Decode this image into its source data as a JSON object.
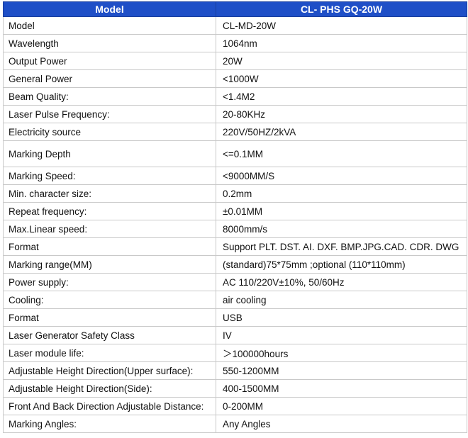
{
  "header": {
    "label_col": "Model",
    "value_col": "CL- PHS GQ-20W"
  },
  "rows": [
    {
      "label": "Model",
      "value": "CL-MD-20W"
    },
    {
      "label": "Wavelength",
      "value": "1064nm"
    },
    {
      "label": "Output Power",
      "value": "20W"
    },
    {
      "label": "General Power",
      "value": "<1000W"
    },
    {
      "label": "Beam Quality:",
      "value": "<1.4M2"
    },
    {
      "label": "Laser Pulse Frequency:",
      "value": "20-80KHz"
    },
    {
      "label": "Electricity source",
      "value": "220V/50HZ/2kVA"
    },
    {
      "label": "Marking Depth",
      "value": "<=0.1MM"
    },
    {
      "label": "Marking Speed:",
      "value": "<9000MM/S"
    },
    {
      "label": "Min. character size:",
      "value": "0.2mm"
    },
    {
      "label": "Repeat frequency:",
      "value": "±0.01MM"
    },
    {
      "label": "Max.Linear speed:",
      "value": "8000mm/s"
    },
    {
      "label": "Format",
      "value": "Support PLT. DST. AI. DXF. BMP.JPG.CAD. CDR. DWG"
    },
    {
      "label": "Marking range(MM)",
      "value": "(standard)75*75mm ;optional (110*110mm)"
    },
    {
      "label": "Power supply:",
      "value": "AC 110/220V±10%, 50/60Hz"
    },
    {
      "label": "Cooling:",
      "value": "air cooling"
    },
    {
      "label": "Format",
      "value": "USB"
    },
    {
      "label": "Laser Generator Safety Class",
      "value": "IV"
    },
    {
      "label": "Laser module life:",
      "value": "＞100000hours"
    },
    {
      "label": "Adjustable Height Direction(Upper surface):",
      "value": "550-1200MM"
    },
    {
      "label": "Adjustable Height Direction(Side):",
      "value": "400-1500MM"
    },
    {
      "label": "Front And Back Direction Adjustable Distance:",
      "value": "0-200MM"
    },
    {
      "label": "Marking Angles:",
      "value": "Any Angles"
    }
  ]
}
